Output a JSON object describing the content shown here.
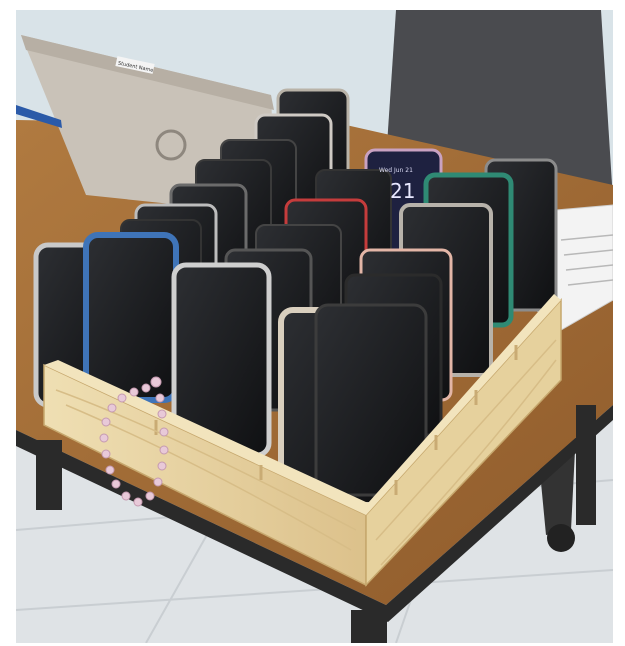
{
  "photo": {
    "laptop_sticker": "Student Name",
    "phone_time": "21",
    "phone_date": "Wed Jun 21"
  },
  "colors": {
    "wall": "#d9e3e8",
    "floor": "#dfe3e6",
    "table_wood": "#a5703a",
    "table_edge": "#2a2a2a",
    "pine": "#ead7a8",
    "pine_dark": "#d9bf86",
    "laptop": "#c9c2b8",
    "chair": "#4a4b4f",
    "paper": "#f3f3f3"
  }
}
